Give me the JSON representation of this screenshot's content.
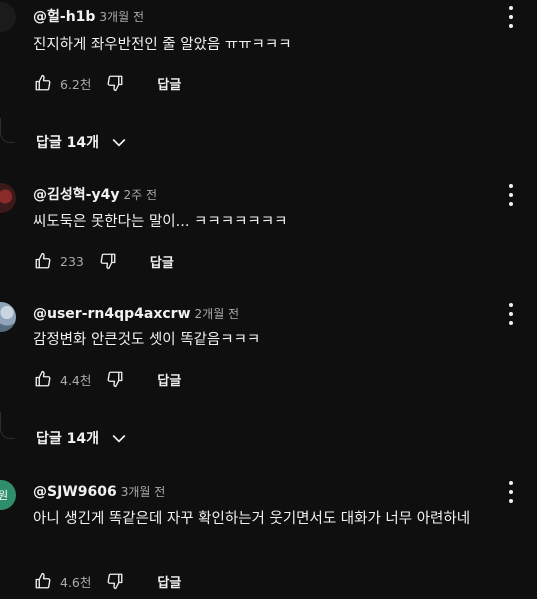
{
  "comments": [
    {
      "author": "@헐-h1b",
      "time": "3개월 전",
      "text": "진지하게 좌우반전인 줄 알았음 ㅠㅠㅋㅋㅋ",
      "likes": "6.2천",
      "reply": "답글",
      "replies": "답글 14개",
      "avatar": "dark-avatar"
    },
    {
      "author": "@김성혁-y4y",
      "time": "2주 전",
      "text": "씨도둑은 못한다는 말이... ㅋㅋㅋㅋㅋㅋㅋ",
      "likes": "233",
      "reply": "답글",
      "avatar": "red-avatar"
    },
    {
      "author": "@user-rn4qp4axcrw",
      "time": "2개월 전",
      "text": "감정변화 안큰것도 셋이 똑같음ㅋㅋㅋ",
      "likes": "4.4천",
      "reply": "답글",
      "replies": "답글 14개",
      "avatar": "sky-avatar"
    },
    {
      "author": "@SJW9606",
      "time": "3개월 전",
      "text": "아니 생긴게 똑같은데 자꾸 확인하는거 웃기면서도 대화가 너무 아련하네",
      "likes": "4.6천",
      "reply": "답글",
      "avatar": "teal-avatar",
      "avatar_text": "원"
    }
  ],
  "icons": {
    "like": "thumbs-up-icon",
    "dislike": "thumbs-down-icon",
    "more": "more-vert-icon",
    "expand": "chevron-down-icon"
  },
  "colors": {
    "background": "#0f0f0f",
    "text": "#f1f1f1",
    "secondary": "#aaaaaa",
    "avatar_teal": "#2f8f6b"
  }
}
